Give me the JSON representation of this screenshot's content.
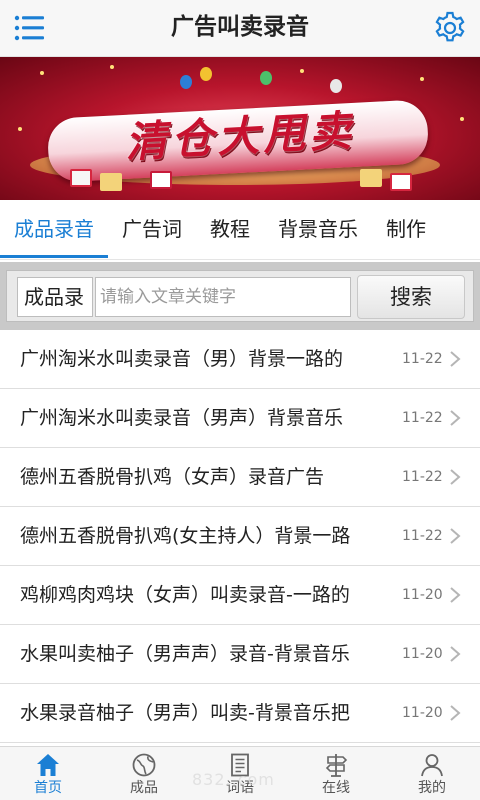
{
  "header": {
    "title": "广告叫卖录音",
    "menu_icon": "hamburger-menu-icon",
    "settings_icon": "gear-icon",
    "accent": "#1b7fd4"
  },
  "banner": {
    "text": "清仓大甩卖"
  },
  "tabs": [
    {
      "label": "成品录音",
      "active": true
    },
    {
      "label": "广告词",
      "active": false
    },
    {
      "label": "教程",
      "active": false
    },
    {
      "label": "背景音乐",
      "active": false
    },
    {
      "label": "制作",
      "active": false
    }
  ],
  "search": {
    "category": "成品录",
    "placeholder": "请输入文章关键字",
    "button_label": "搜索"
  },
  "list": [
    {
      "title": "广州淘米水叫卖录音（男）背景一路的",
      "date": "11-22"
    },
    {
      "title": "广州淘米水叫卖录音（男声）背景音乐",
      "date": "11-22"
    },
    {
      "title": "德州五香脱骨扒鸡（女声）录音广告",
      "date": "11-22"
    },
    {
      "title": "德州五香脱骨扒鸡(女主持人）背景一路",
      "date": "11-22"
    },
    {
      "title": "鸡柳鸡肉鸡块（女声）叫卖录音-一路的",
      "date": "11-20"
    },
    {
      "title": "水果叫卖柚子（男声声）录音-背景音乐",
      "date": "11-20"
    },
    {
      "title": "水果录音柚子（男声）叫卖-背景音乐把",
      "date": "11-20"
    }
  ],
  "bottom_nav": [
    {
      "label": "首页",
      "icon": "home-icon",
      "active": true
    },
    {
      "label": "成品",
      "icon": "globe-icon",
      "active": false
    },
    {
      "label": "词语",
      "icon": "document-icon",
      "active": false
    },
    {
      "label": "在线",
      "icon": "sign-post-icon",
      "active": false
    },
    {
      "label": "我的",
      "icon": "user-icon",
      "active": false
    }
  ],
  "watermark": "832..com"
}
